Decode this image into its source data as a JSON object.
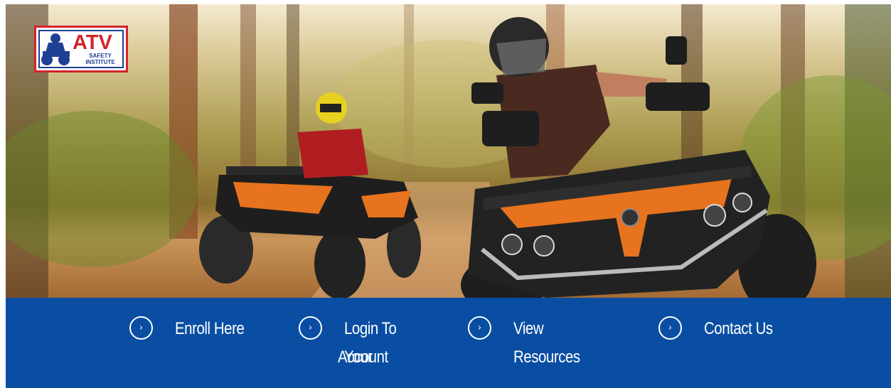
{
  "logo": {
    "brand": "ATV",
    "subtitle_line1": "SAFETY",
    "subtitle_line2": "INSTITUTE"
  },
  "colors": {
    "nav_background": "#0a4ea3",
    "logo_red": "#d3242c",
    "logo_blue": "#1d3f94",
    "atv_orange": "#e8731e"
  },
  "nav": {
    "items": [
      {
        "label": "Enroll Here",
        "icon": "chevron-right-circle-icon"
      },
      {
        "label_line1": "Login To Your",
        "label_line2": "Account",
        "icon": "chevron-right-circle-icon"
      },
      {
        "label": "View Resources",
        "icon": "chevron-right-circle-icon"
      },
      {
        "label": "Contact Us",
        "icon": "chevron-right-circle-icon"
      }
    ],
    "icon_glyph": "›"
  }
}
